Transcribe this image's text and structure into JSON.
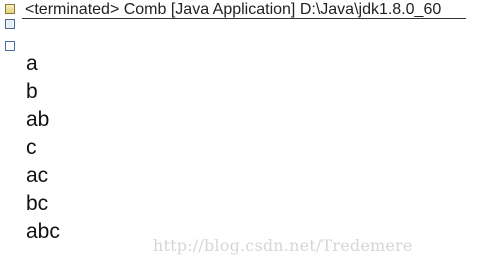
{
  "console": {
    "header": "<terminated> Comb [Java Application] D:\\Java\\jdk1.8.0_60",
    "output_lines": [
      "a",
      "b",
      "ab",
      "c",
      "ac",
      "bc",
      "abc"
    ]
  },
  "watermark": {
    "text": "http://blog.csdn.net/Tredemere"
  },
  "icons": {
    "top": "pin-icon",
    "mid": "console-toggle-icon",
    "bottom": "window-icon"
  }
}
